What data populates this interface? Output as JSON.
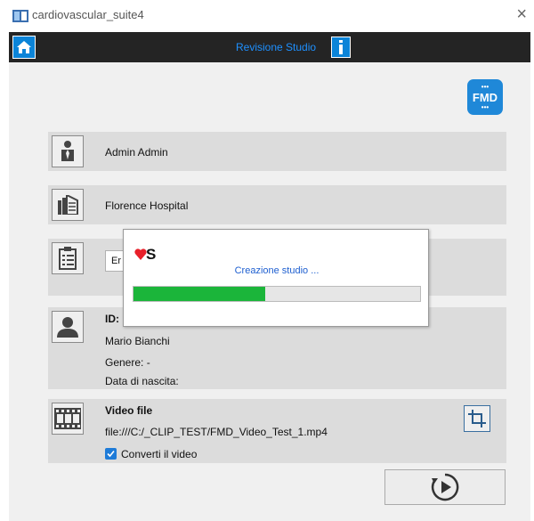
{
  "window": {
    "title": "cardiovascular_suite4",
    "close_glyph": "×"
  },
  "topbar": {
    "title": "Revisione Studio",
    "home_icon": "home-icon",
    "info_icon": "info-icon"
  },
  "brand": {
    "logo_text": "FMD",
    "accent": "#1f88d8"
  },
  "operator": {
    "name": "Admin Admin",
    "icon": "user-tie-icon"
  },
  "hospital": {
    "name": "Florence Hospital",
    "icon": "building-icon"
  },
  "study": {
    "field_value": "Er",
    "icon": "clipboard-icon"
  },
  "patient": {
    "id_label": "ID:",
    "name": "Mario  Bianchi",
    "gender": "Genere: -",
    "birth": "Data di nascita:",
    "icon": "person-icon"
  },
  "video": {
    "label": "Video file",
    "path": "file:///C:/_CLIP_TEST/FMD_Video_Test_1.mp4",
    "convert_label": "Converti il video",
    "convert_checked": true,
    "icon": "film-icon",
    "crop_icon": "crop-icon"
  },
  "action": {
    "play_icon": "play-icon"
  },
  "dialog": {
    "logo_text": "S",
    "status": "Creazione studio ...",
    "progress": 0.46,
    "progress_color": "#1bb53a"
  }
}
